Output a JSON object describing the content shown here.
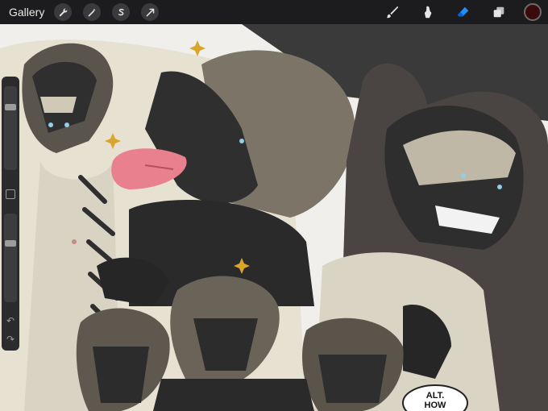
{
  "toolbar": {
    "gallery_label": "Gallery"
  },
  "colors": {
    "current_color": "#3b0b0b",
    "eraser_active": "#1e90ff"
  },
  "artwork": {
    "speech_text": "ALT. HOW"
  }
}
